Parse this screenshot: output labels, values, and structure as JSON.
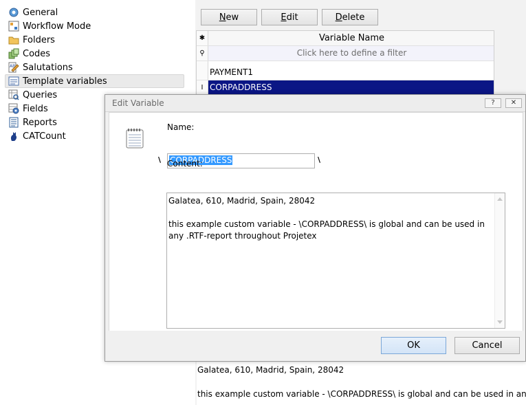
{
  "nav": {
    "items": [
      {
        "label": "General",
        "icon": "general-icon"
      },
      {
        "label": "Workflow Mode",
        "icon": "workflow-icon"
      },
      {
        "label": "Folders",
        "icon": "folder-icon"
      },
      {
        "label": "Codes",
        "icon": "codes-icon"
      },
      {
        "label": "Salutations",
        "icon": "salutations-icon"
      },
      {
        "label": "Template variables",
        "icon": "template-variables-icon"
      },
      {
        "label": "Queries",
        "icon": "queries-icon"
      },
      {
        "label": "Fields",
        "icon": "fields-icon"
      },
      {
        "label": "Reports",
        "icon": "reports-icon"
      },
      {
        "label": "CATCount",
        "icon": "catcount-icon"
      }
    ],
    "selected": "Template variables"
  },
  "toolbar": {
    "new_label": "New",
    "edit_label": "Edit",
    "delete_label": "Delete"
  },
  "grid": {
    "header": "Variable Name",
    "filter_hint": "Click here to define a filter",
    "rows": [
      "PAYMENT1",
      "CORPADDRESS"
    ],
    "selected_row": "CORPADDRESS"
  },
  "preview": {
    "line1": "Galatea, 610, Madrid, Spain, 28042",
    "line2": "this example custom variable - \\CORPADDRESS\\ is global and can be used in any"
  },
  "dialog": {
    "title": "Edit Variable",
    "help_label": "?",
    "close_label": "✕",
    "name_label": "Name:",
    "name_value": "CORPADDRESS",
    "slash": "\\",
    "content_label": "Content:",
    "content_line1": "Galatea, 610, Madrid, Spain, 28042",
    "content_line2": "this example custom variable - \\CORPADDRESS\\ is global and can be used in",
    "content_line3": "any .RTF-report throughout Projetex",
    "ok_label": "OK",
    "cancel_label": "Cancel"
  },
  "colors": {
    "selection": "#0b1685",
    "text_highlight": "#3399ff",
    "default_button": "#d3e4f7"
  }
}
